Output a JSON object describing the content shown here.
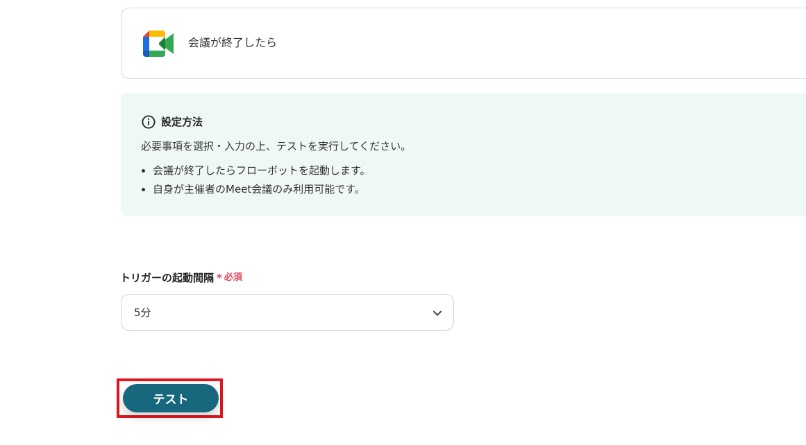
{
  "trigger": {
    "app_icon": "google-meet-icon",
    "label": "会議が終了したら"
  },
  "info": {
    "icon": "info-circle-icon",
    "title": "設定方法",
    "description": "必要事項を選択・入力の上、テストを実行してください。",
    "items": [
      "会議が終了したらフローボットを起動します。",
      "自身が主催者のMeet会議のみ利用可能です。"
    ]
  },
  "field": {
    "label": "トリガーの起動間隔",
    "required_mark": "*",
    "required_text": "必須",
    "value": "5分",
    "dropdown_icon": "chevron-down-icon"
  },
  "actions": {
    "test_label": "テスト"
  },
  "colors": {
    "accent": "#17677d",
    "required": "#e0485a",
    "info_bg": "#f0f8f7",
    "highlight": "#e0161f"
  }
}
